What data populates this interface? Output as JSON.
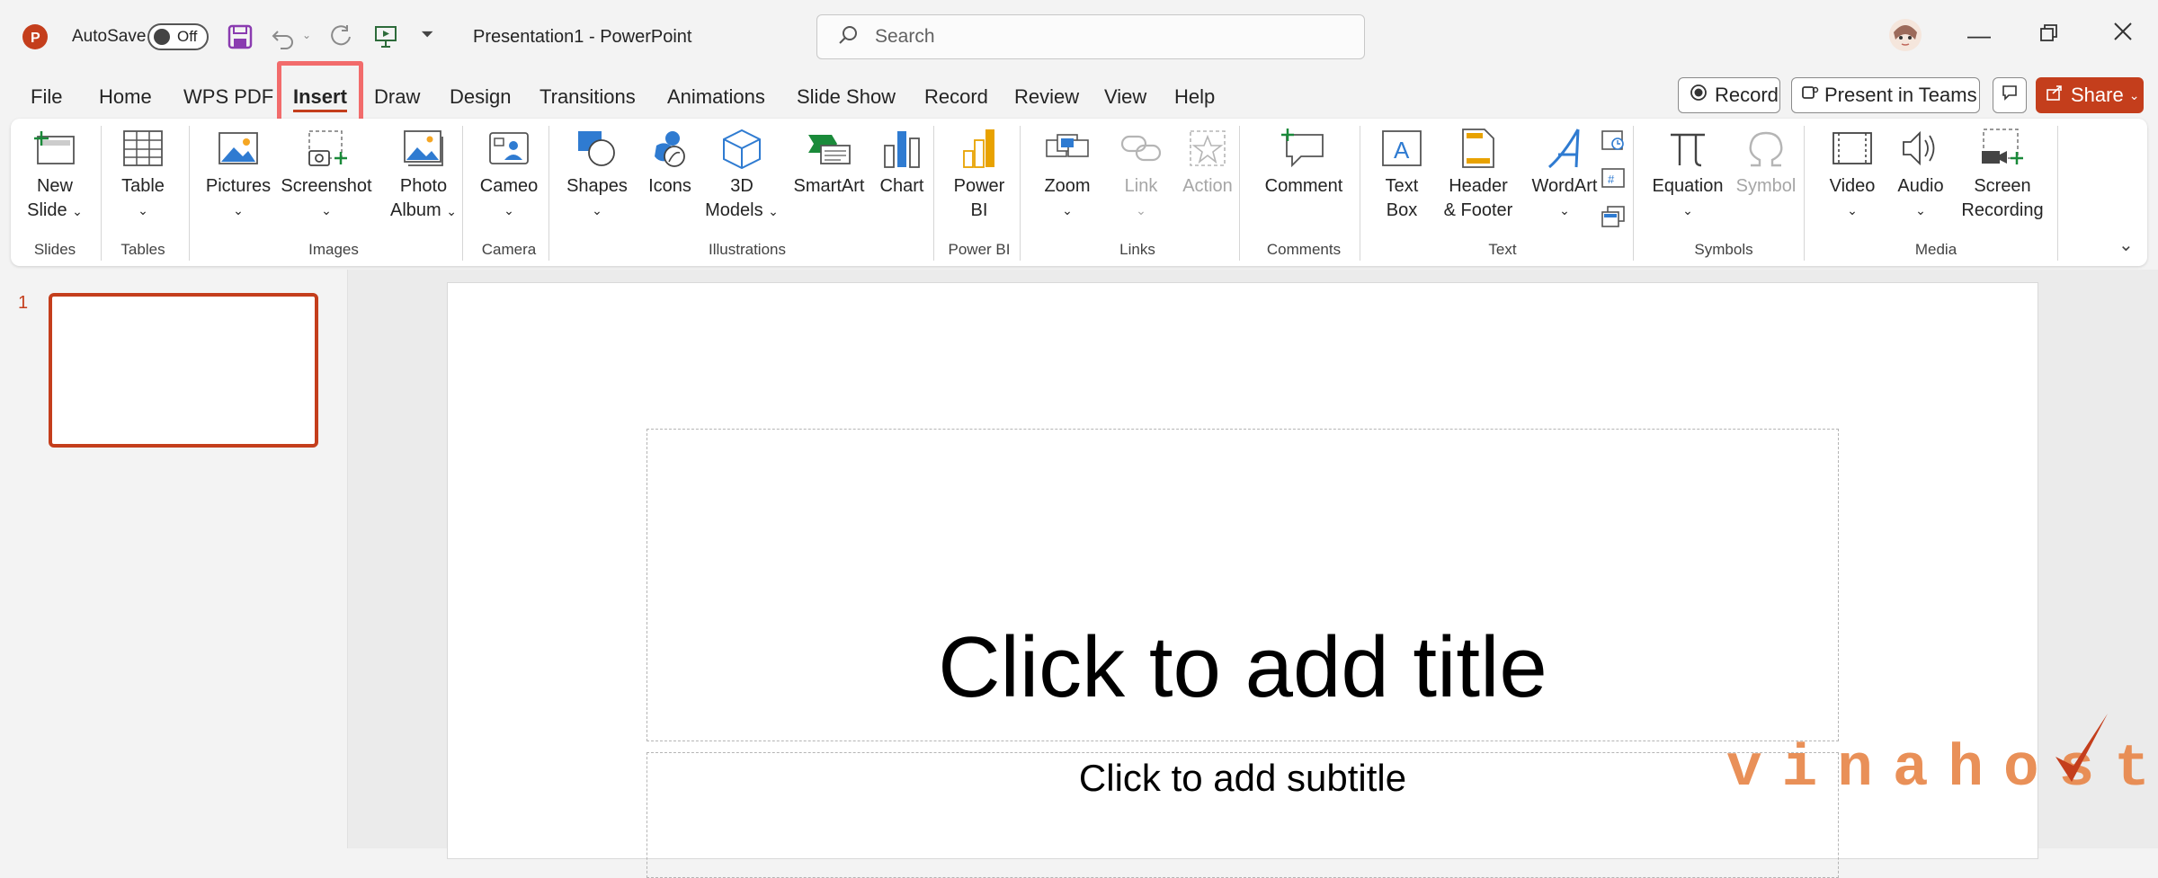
{
  "titlebar": {
    "autosave_label": "AutoSave",
    "autosave_state": "Off",
    "doc_title": "Presentation1  -  PowerPoint",
    "search_placeholder": "Search"
  },
  "tabs": [
    {
      "label": "File"
    },
    {
      "label": "Home"
    },
    {
      "label": "WPS PDF"
    },
    {
      "label": "Insert",
      "active": true
    },
    {
      "label": "Draw"
    },
    {
      "label": "Design"
    },
    {
      "label": "Transitions"
    },
    {
      "label": "Animations"
    },
    {
      "label": "Slide Show"
    },
    {
      "label": "Record"
    },
    {
      "label": "Review"
    },
    {
      "label": "View"
    },
    {
      "label": "Help"
    }
  ],
  "right_buttons": {
    "record": "Record",
    "present": "Present in Teams",
    "share": "Share"
  },
  "ribbon": {
    "new_slide": [
      "New",
      "Slide"
    ],
    "table": "Table",
    "pictures": "Pictures",
    "screenshot": "Screenshot",
    "photo_album": [
      "Photo",
      "Album"
    ],
    "cameo": "Cameo",
    "shapes": "Shapes",
    "icons": "Icons",
    "models": [
      "3D",
      "Models"
    ],
    "smartart": "SmartArt",
    "chart": "Chart",
    "powerbi": [
      "Power",
      "BI"
    ],
    "zoom": "Zoom",
    "link": "Link",
    "action": "Action",
    "comment": "Comment",
    "textbox": [
      "Text",
      "Box"
    ],
    "header_footer": [
      "Header",
      "& Footer"
    ],
    "wordart": "WordArt",
    "equation": "Equation",
    "symbol": "Symbol",
    "video": "Video",
    "audio": "Audio",
    "screen_recording": [
      "Screen",
      "Recording"
    ]
  },
  "groups": {
    "slides": "Slides",
    "tables": "Tables",
    "images": "Images",
    "camera": "Camera",
    "illustrations": "Illustrations",
    "powerbi": "Power BI",
    "links": "Links",
    "comments": "Comments",
    "text": "Text",
    "symbols": "Symbols",
    "media": "Media"
  },
  "slide_number": "1",
  "slide": {
    "title_placeholder": "Click to add title",
    "subtitle_placeholder": "Click to add subtitle"
  },
  "watermark": "vinahost.",
  "colors": {
    "accent": "#c43e1c",
    "highlight": "#f26b6b"
  }
}
